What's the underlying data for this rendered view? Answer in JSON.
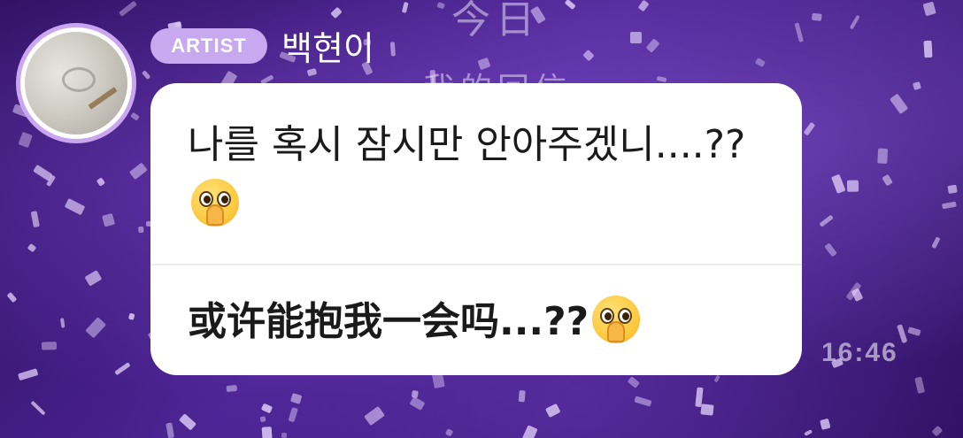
{
  "chat": {
    "sender": {
      "badge": "ARTIST",
      "name": "백현이"
    },
    "message": {
      "korean": "나를 혹시 잠시만 안아주겠니....??",
      "chinese": "或许能抱我一会吗...??",
      "emoji": "pleading-face-with-folded-hands"
    },
    "timestamp": "16:46"
  },
  "background": {
    "overlay_text_1": "今日",
    "overlay_text_2": "我的回信"
  },
  "colors": {
    "badge": "#c8a8ee",
    "avatar_ring": "#c9a6ef",
    "bubble": "#ffffff",
    "background": "#3a1a6b"
  }
}
